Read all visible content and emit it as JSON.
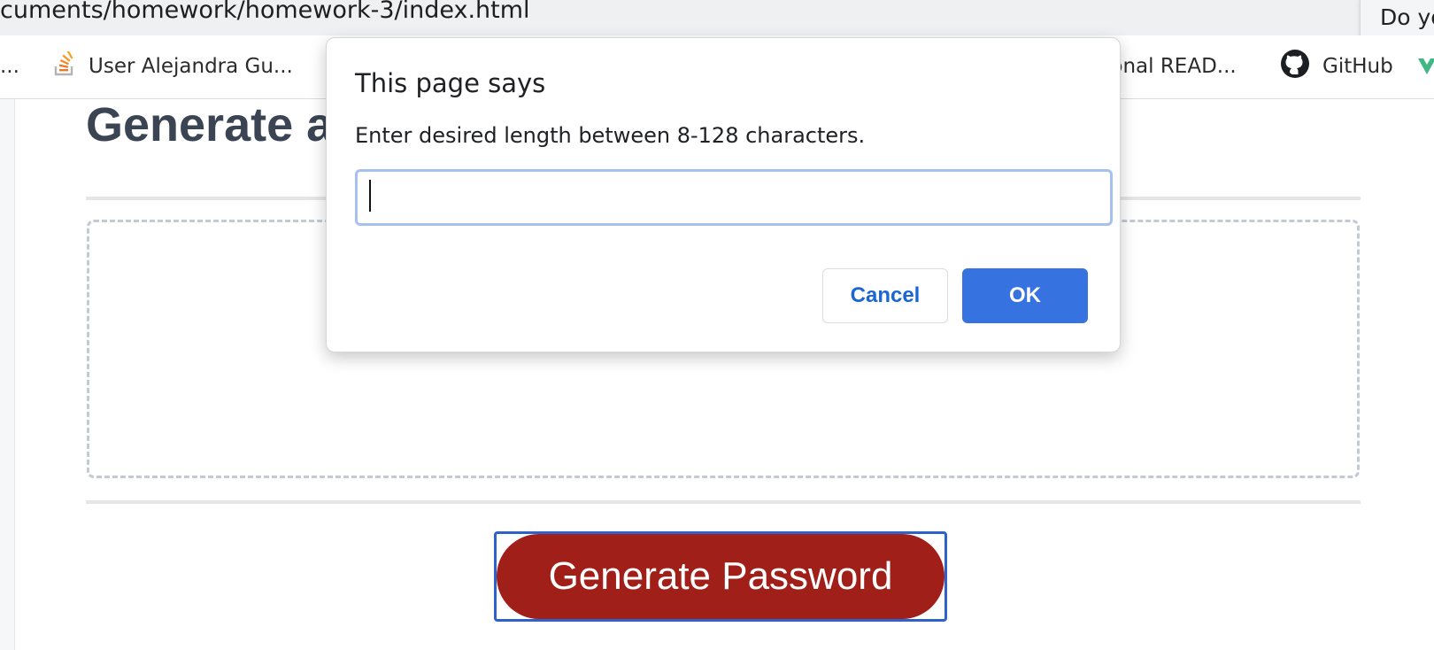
{
  "browser": {
    "url": "cuments/homework/homework-3/index.html",
    "popup_text": "Do yo",
    "bookmarks": [
      {
        "label": "...",
        "icon": "bookmark-icon"
      },
      {
        "label": "User Alejandra Gu...",
        "icon": "stackoverflow-icon"
      },
      {
        "label": "sional READ...",
        "icon": "bookmark-icon"
      },
      {
        "label": "GitHub",
        "icon": "github-icon"
      }
    ]
  },
  "page": {
    "heading": "Generate a",
    "generate_button_label": "Generate Password"
  },
  "dialog": {
    "title": "This page says",
    "message": "Enter desired length between 8-128 characters.",
    "input_value": "",
    "cancel_label": "Cancel",
    "ok_label": "OK"
  },
  "colors": {
    "generate_button": "#a11f19",
    "ok_button": "#3773e0",
    "focus_ring": "#a6c1f0",
    "cancel_text": "#1a66d2"
  }
}
